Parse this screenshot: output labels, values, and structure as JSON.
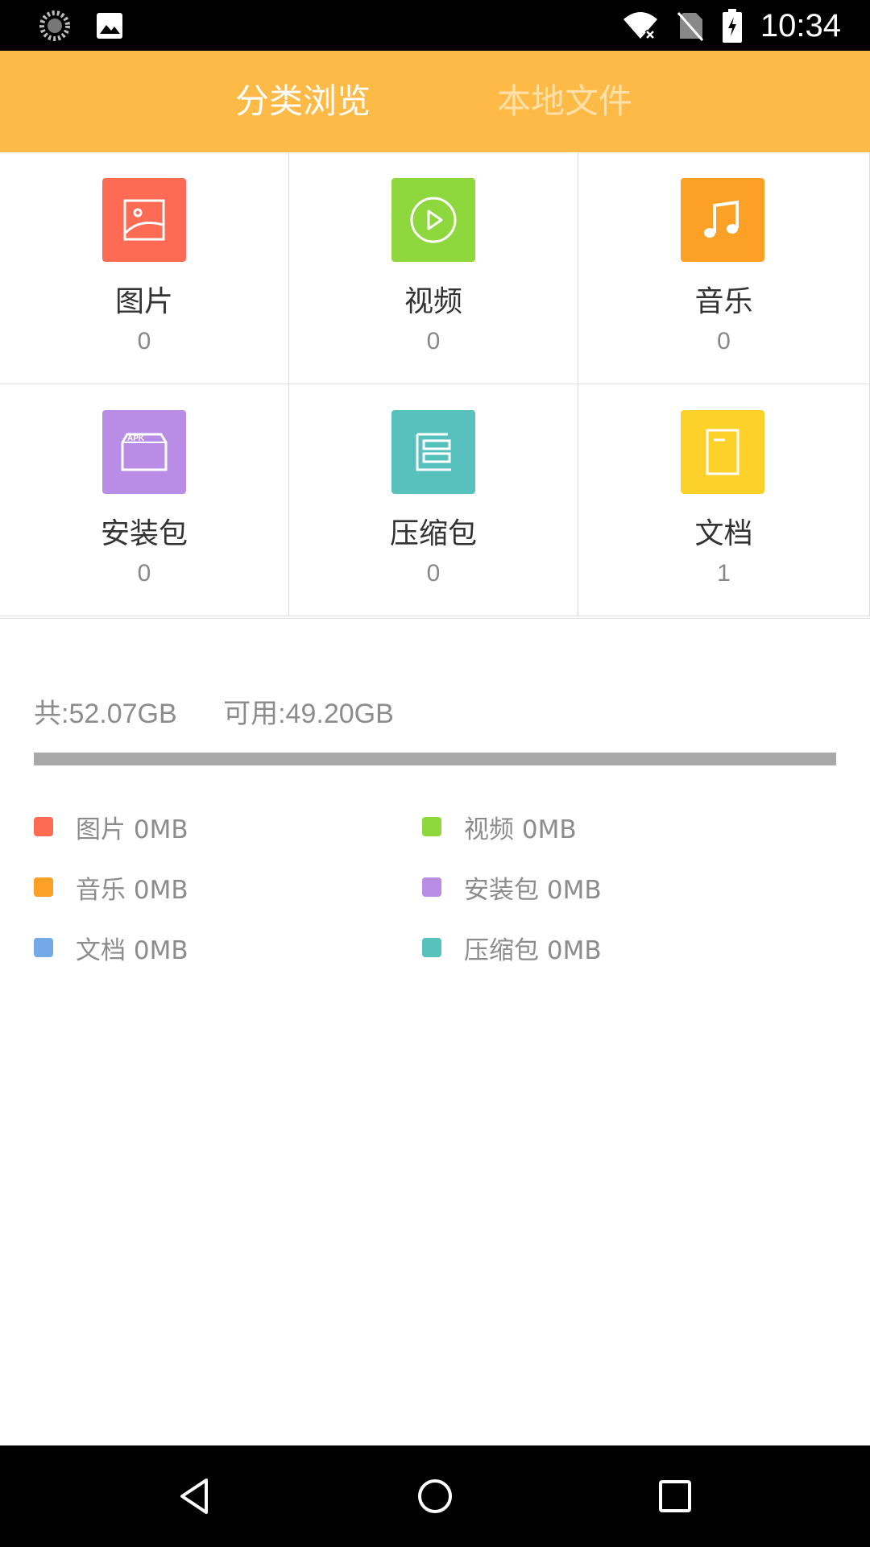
{
  "status_bar": {
    "time": "10:34",
    "left_icons": [
      "loading-circle-icon",
      "image-icon"
    ],
    "right_icons": [
      "wifi-off-icon",
      "no-sim-icon",
      "battery-charging-icon"
    ]
  },
  "header": {
    "tabs": [
      {
        "label": "分类浏览",
        "active": true
      },
      {
        "label": "本地文件",
        "active": false
      }
    ],
    "color": "#FDBA47"
  },
  "categories": [
    {
      "label": "图片",
      "count": "0",
      "color": "#FD6B54",
      "icon": "image-icon"
    },
    {
      "label": "视频",
      "count": "0",
      "color": "#8ED83E",
      "icon": "play-circle-icon"
    },
    {
      "label": "音乐",
      "count": "0",
      "color": "#FDA026",
      "icon": "music-note-icon"
    },
    {
      "label": "安装包",
      "count": "0",
      "color": "#B98CE5",
      "icon": "apk-box-icon"
    },
    {
      "label": "压缩包",
      "count": "0",
      "color": "#58C1BE",
      "icon": "archive-icon"
    },
    {
      "label": "文档",
      "count": "1",
      "color": "#FCD22A",
      "icon": "document-icon"
    }
  ],
  "storage": {
    "total": "共:52.07GB",
    "available": "可用:49.20GB",
    "bar_color": "#a8a8a8"
  },
  "legend": [
    {
      "label": "图片 0MB",
      "color": "#FD6B54"
    },
    {
      "label": "视频 0MB",
      "color": "#8ED83E"
    },
    {
      "label": "音乐 0MB",
      "color": "#FDA026"
    },
    {
      "label": "安装包 0MB",
      "color": "#B98CE5"
    },
    {
      "label": "文档 0MB",
      "color": "#74A9E8"
    },
    {
      "label": "压缩包 0MB",
      "color": "#58C1BE"
    }
  ],
  "nav_bar": {
    "buttons": [
      "back-icon",
      "home-icon",
      "recents-icon"
    ]
  }
}
